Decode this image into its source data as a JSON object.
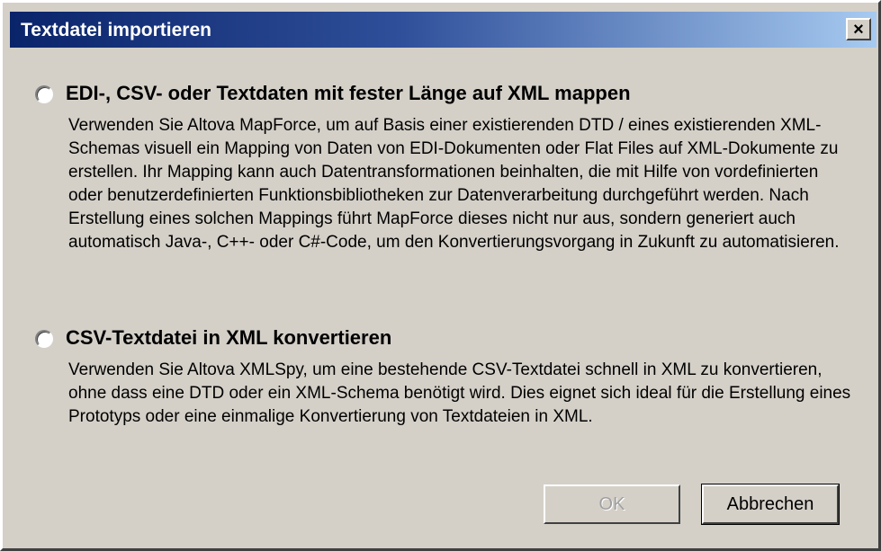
{
  "window": {
    "title": "Textdatei importieren",
    "close_label": "×"
  },
  "options": [
    {
      "label": "EDI-, CSV- oder Textdaten mit fester Länge auf XML mappen",
      "description": "Verwenden Sie Altova MapForce, um auf Basis einer existierenden DTD / eines existierenden XML-Schemas visuell ein Mapping von Daten von EDI-Dokumenten oder Flat Files auf XML-Dokumente zu erstellen. Ihr Mapping kann auch Datentransformationen beinhalten, die mit Hilfe von vordefinierten oder benutzerdefinierten Funktionsbibliotheken zur Datenverarbeitung durchgeführt werden. Nach Erstellung eines solchen Mappings führt MapForce dieses nicht nur aus, sondern generiert auch automatisch Java-, C++- oder C#-Code, um den Konvertierungsvorgang in Zukunft zu automatisieren.",
      "selected": false
    },
    {
      "label": "CSV-Textdatei in XML konvertieren",
      "description": "Verwenden Sie Altova XMLSpy, um eine bestehende CSV-Textdatei schnell in XML zu konvertieren, ohne dass eine DTD oder ein XML-Schema benötigt wird. Dies eignet sich ideal für die Erstellung eines Prototyps oder eine einmalige Konvertierung von Textdateien in XML.",
      "selected": false
    }
  ],
  "buttons": {
    "ok_label": "OK",
    "ok_enabled": false,
    "cancel_label": "Abbrechen"
  }
}
